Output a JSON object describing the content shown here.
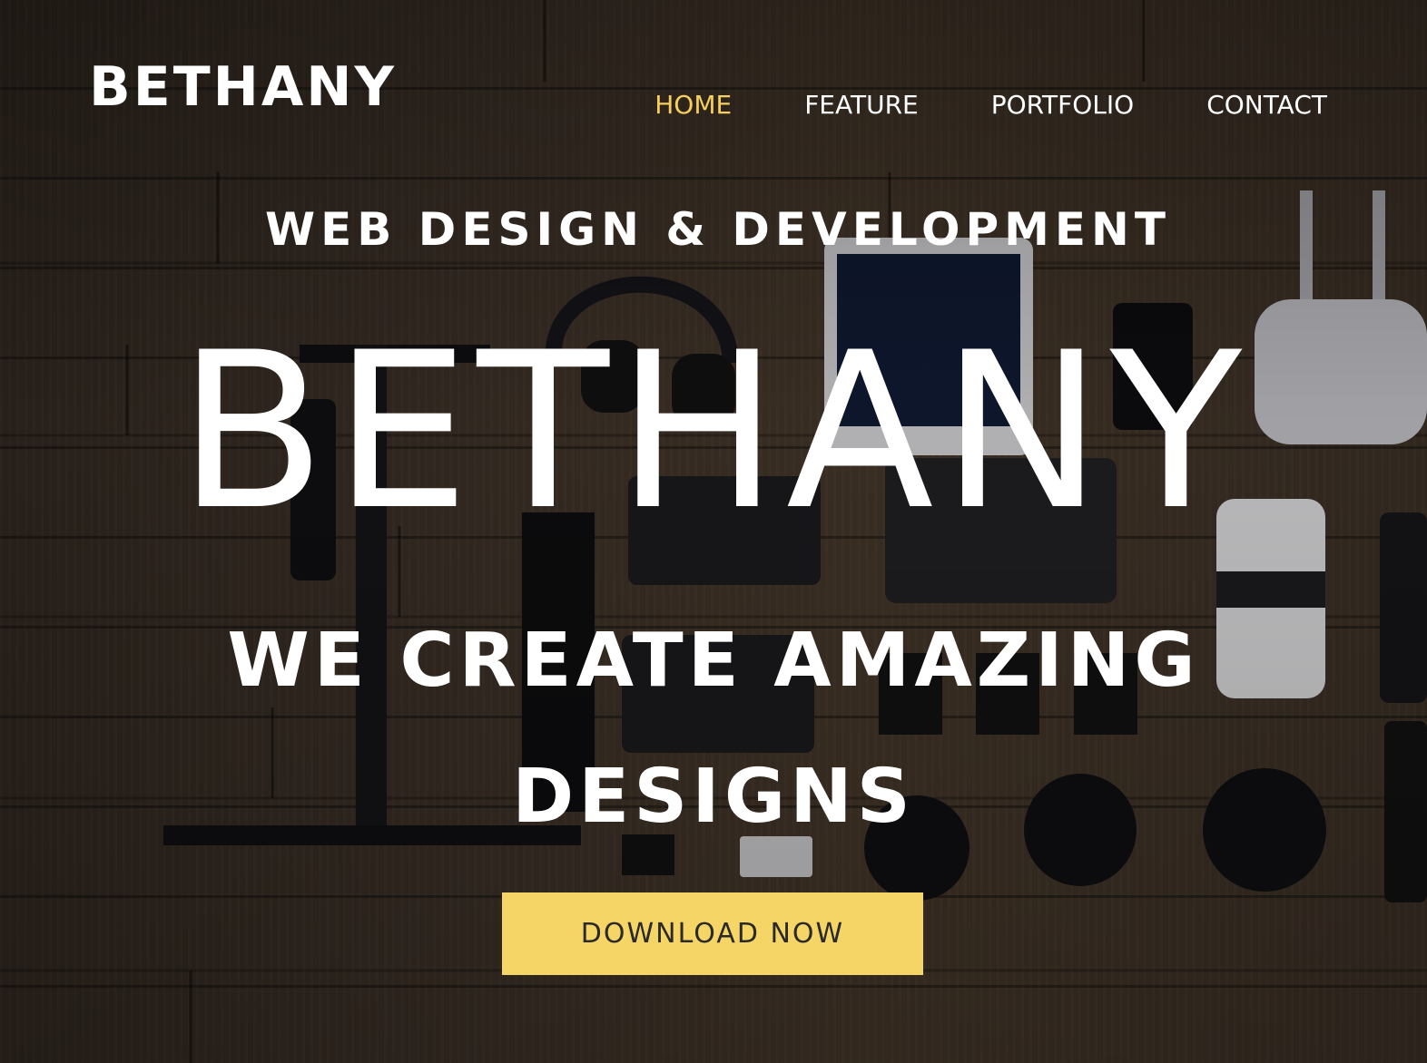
{
  "header": {
    "logo": "BETHANY",
    "nav": [
      {
        "label": "HOME",
        "active": true
      },
      {
        "label": "FEATURE",
        "active": false
      },
      {
        "label": "PORTFOLIO",
        "active": false
      },
      {
        "label": "CONTACT",
        "active": false
      }
    ]
  },
  "hero": {
    "tagline": "WEB DESIGN & DEVELOPMENT",
    "title": "BETHANY",
    "subtitle_line1": "WE CREATE AMAZING",
    "subtitle_line2": "DESIGNS",
    "cta_label": "DOWNLOAD NOW"
  },
  "colors": {
    "accent": "#f6cf5f",
    "button": "#f6d567",
    "text": "#ffffff"
  }
}
